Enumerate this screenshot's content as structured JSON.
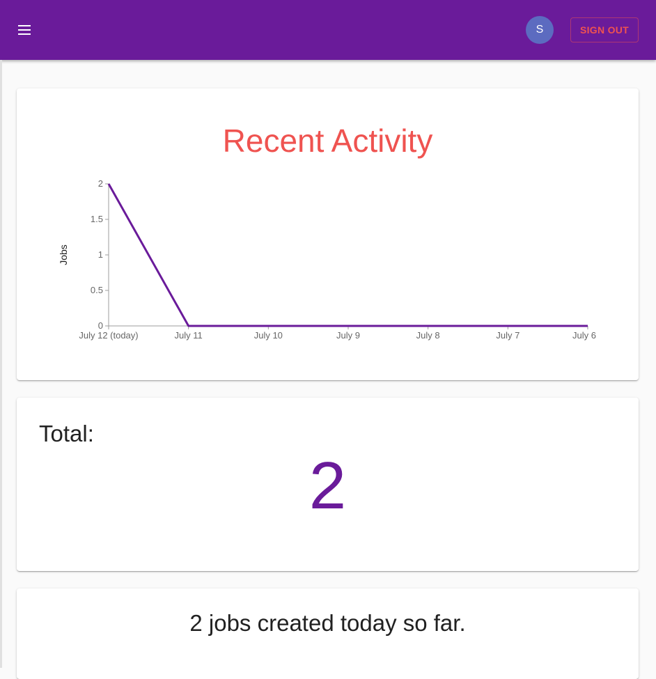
{
  "header": {
    "avatar_initial": "S",
    "sign_out_label": "SIGN OUT",
    "menu_icon": "menu-icon"
  },
  "activity": {
    "title": "Recent Activity"
  },
  "chart_data": {
    "type": "line",
    "title": "",
    "xlabel": "",
    "ylabel": "Jobs",
    "categories": [
      "July 12 (today)",
      "July 11",
      "July 10",
      "July 9",
      "July 8",
      "July 7",
      "July 6"
    ],
    "series": [
      {
        "values": [
          2,
          0,
          0,
          0,
          0,
          0,
          0
        ]
      }
    ],
    "yticks": [
      "0",
      "0.5",
      "1",
      "1.5",
      "2"
    ],
    "ylim": [
      0,
      2
    ],
    "grid": false,
    "line_color": "#6a1b9a"
  },
  "total": {
    "label": "Total:",
    "value": "2"
  },
  "today": {
    "text": "2 jobs created today so far."
  },
  "colors": {
    "app_bar": "#6a1b9a",
    "accent": "#ef5350",
    "avatar": "#5c6bc0"
  }
}
